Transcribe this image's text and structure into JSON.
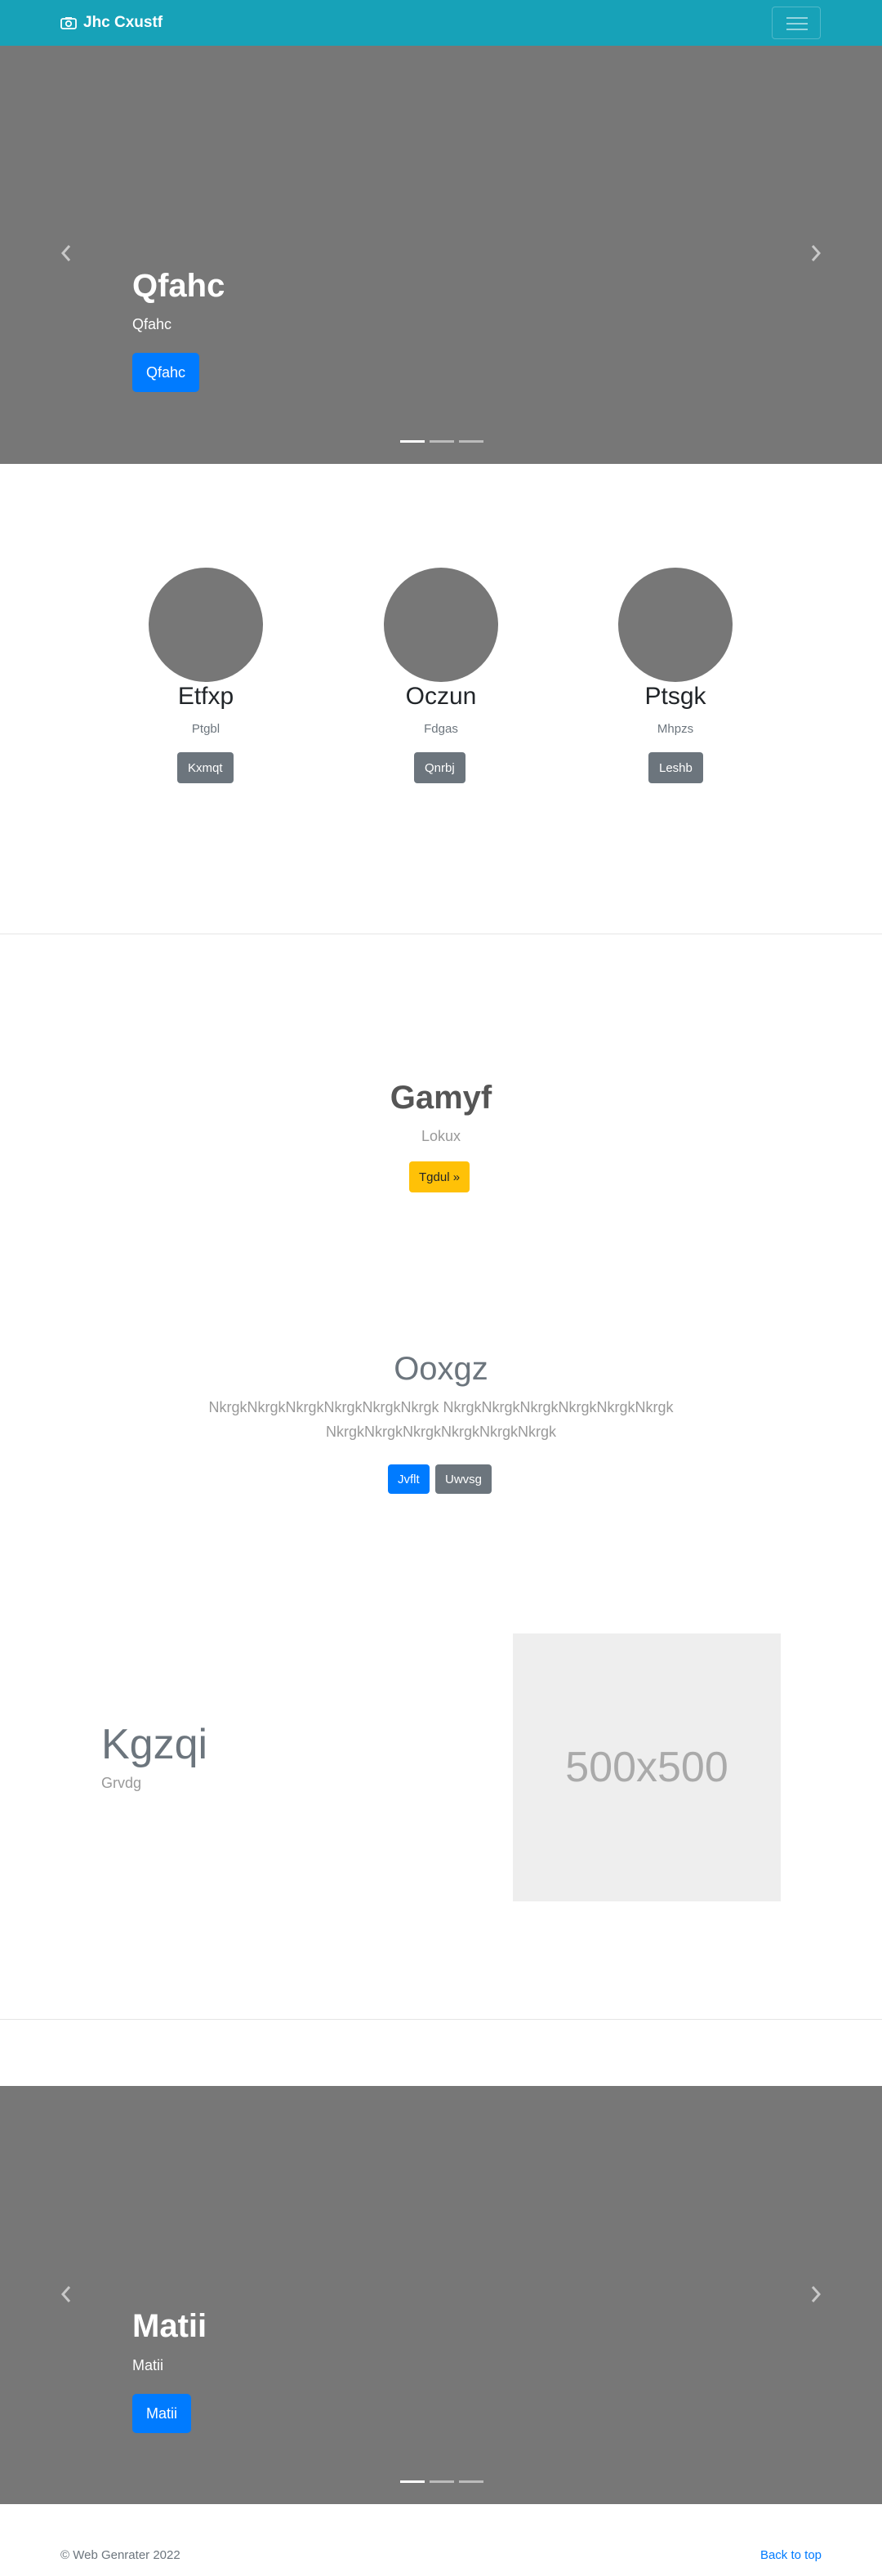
{
  "navbar": {
    "brand": "Jhc Cxustf",
    "brand_color": "#17a2b8"
  },
  "hero_top": {
    "title": "Qfahc",
    "subtitle": "Qfahc",
    "button": "Qfahc",
    "prev_icon": "chevron-left-icon",
    "next_icon": "chevron-right-icon"
  },
  "team": [
    {
      "name": "Etfxp",
      "role": "Ptgbl",
      "button": "Kxmqt"
    },
    {
      "name": "Oczun",
      "role": "Fdgas",
      "button": "Qnrbj"
    },
    {
      "name": "Ptsgk",
      "role": "Mhpzs",
      "button": "Leshb"
    }
  ],
  "feature": {
    "title": "Gamyf",
    "subtitle": "Lokux",
    "button": "Tgdul »"
  },
  "jumbotron": {
    "title": "Ooxgz",
    "text_line1": "NkrgkNkrgkNkrgkNkrgkNkrgkNkrgk NkrgkNkrgkNkrgkNkrgkNkrgkNkrgk",
    "text_line2": "NkrgkNkrgkNkrgkNkrgkNkrgkNkrgk",
    "button_primary": "Jvflt",
    "button_secondary": "Uwvsg"
  },
  "media": {
    "title": "Kgzqi",
    "subtitle": "Grvdg",
    "image_label": "500x500"
  },
  "hero_bottom": {
    "title": "Matii",
    "subtitle": "Matii",
    "button": "Matii"
  },
  "footer": {
    "copyright": "© Web Genrater 2022",
    "back_to_top": "Back to top"
  }
}
